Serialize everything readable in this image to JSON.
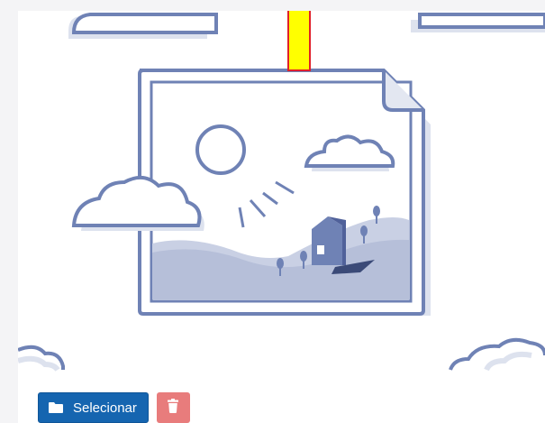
{
  "upload": {
    "placeholder_icon": "image-placeholder-illustration",
    "select_label": "Selecionar",
    "select_icon": "folder-icon",
    "delete_icon": "trash-icon"
  },
  "colors": {
    "illustration_stroke": "#6f82b5",
    "illustration_fill": "#e3e7f1",
    "select_button": "#1565b0",
    "delete_button": "#e87c7c",
    "marker": "#ffff00"
  }
}
